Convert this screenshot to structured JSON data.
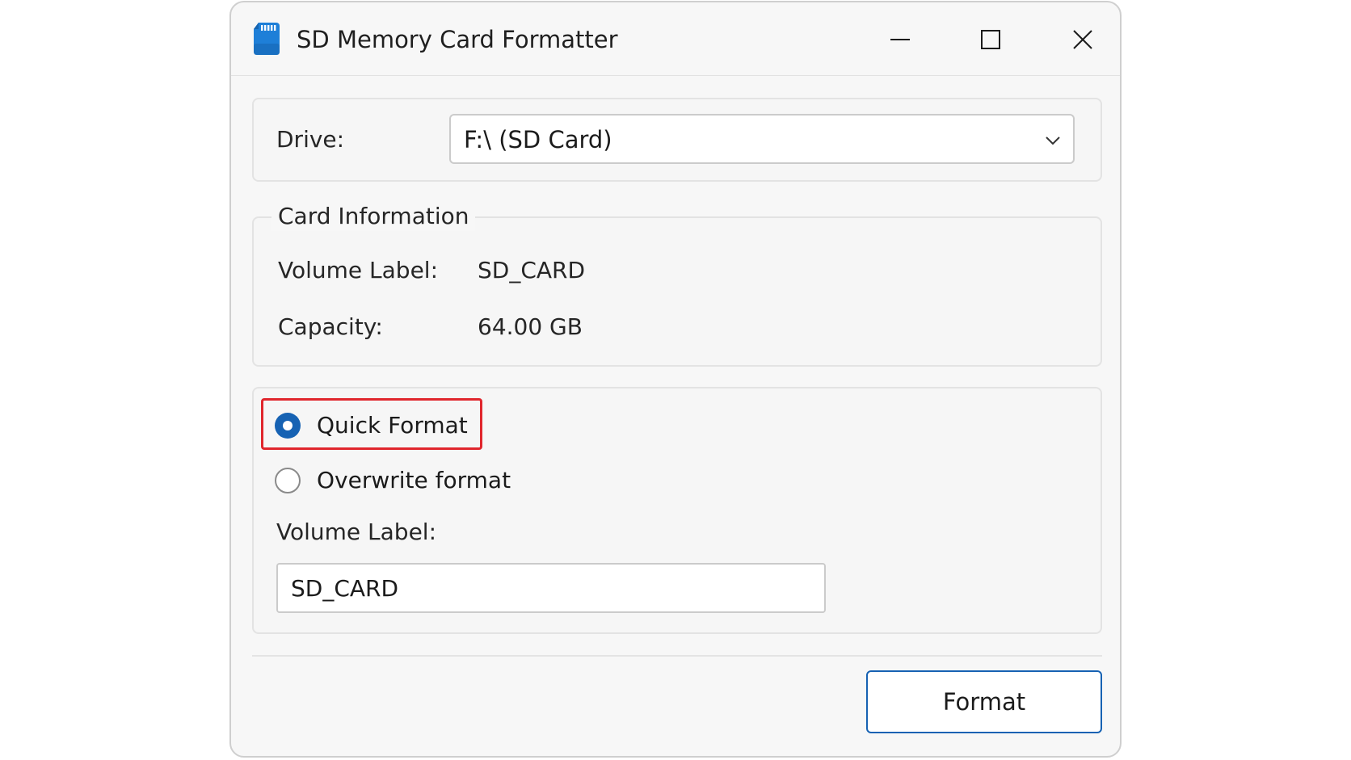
{
  "window": {
    "title": "SD Memory Card Formatter",
    "icon": "sd-card-icon"
  },
  "titlebar_buttons": {
    "minimize_icon": "minimize-icon",
    "maximize_icon": "maximize-icon",
    "close_icon": "close-icon"
  },
  "drive": {
    "label": "Drive:",
    "selected": "F:\\ (SD Card)",
    "dropdown_icon": "chevron-down-icon"
  },
  "card_information": {
    "title": "Card Information",
    "volume_label_label": "Volume Label:",
    "volume_label_value": "SD_CARD",
    "capacity_label": "Capacity:",
    "capacity_value": "64.00 GB"
  },
  "format_options": {
    "quick_format_label": "Quick Format",
    "quick_format_selected": true,
    "overwrite_format_label": "Overwrite format",
    "overwrite_format_selected": false,
    "volume_label_field_label": "Volume Label:",
    "volume_label_field_value": "SD_CARD"
  },
  "actions": {
    "format_label": "Format"
  },
  "colors": {
    "accent": "#1662b3",
    "highlight": "#e0262d"
  }
}
